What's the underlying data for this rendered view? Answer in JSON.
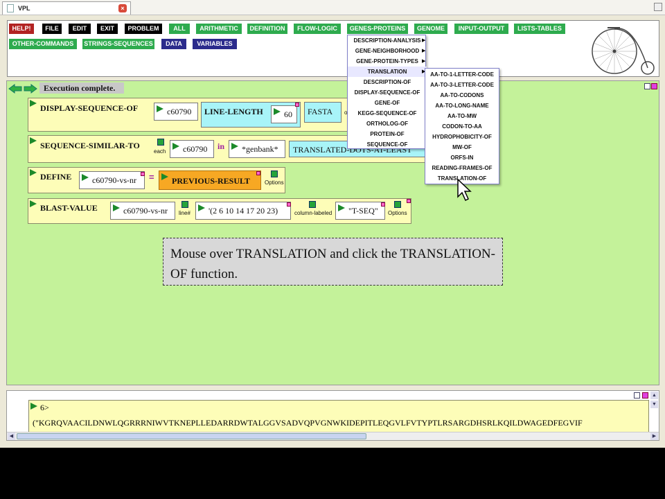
{
  "window": {
    "tab_title": "VPL"
  },
  "menubar": {
    "row1": [
      {
        "label": "HELP!",
        "color": "red"
      },
      {
        "label": "FILE",
        "color": "black"
      },
      {
        "label": "EDIT",
        "color": "black"
      },
      {
        "label": "EXIT",
        "color": "black"
      },
      {
        "label": "PROBLEM",
        "color": "black"
      },
      {
        "label": "ALL",
        "color": "green"
      },
      {
        "label": "ARITHMETIC",
        "color": "green"
      },
      {
        "label": "DEFINITION",
        "color": "green"
      },
      {
        "label": "FLOW-LOGIC",
        "color": "green"
      },
      {
        "label": "GENES-PROTEINS",
        "color": "green"
      },
      {
        "label": "GENOME",
        "color": "green"
      },
      {
        "label": "INPUT-OUTPUT",
        "color": "green"
      },
      {
        "label": "LISTS-TABLES",
        "color": "green"
      }
    ],
    "row2": [
      {
        "label": "OTHER-COMMANDS",
        "color": "green"
      },
      {
        "label": "STRINGS-SEQUENCES",
        "color": "green"
      },
      {
        "label": "DATA",
        "color": "blue"
      },
      {
        "label": "VARIABLES",
        "color": "blue"
      }
    ]
  },
  "workspace": {
    "status": "Execution complete.",
    "blocks": {
      "display": {
        "name": "DISPLAY-SEQUENCE-OF",
        "arg1": "c60790",
        "line_length_label": "LINE-LENGTH",
        "line_length_value": "60",
        "format": "FASTA",
        "trailing": "o"
      },
      "similar": {
        "name": "SEQUENCE-SIMILAR-TO",
        "each": "each",
        "arg1": "c60790",
        "in": "in",
        "arg2": "*genbank*",
        "translate_label": "TRANSLATED-DOTS-AT-LEAST"
      },
      "define": {
        "name": "DEFINE",
        "var": "c60790-vs-nr",
        "eq": "=",
        "value": "PREVIOUS-RESULT",
        "options": "Options"
      },
      "blast": {
        "name": "BLAST-VALUE",
        "arg1": "c60790-vs-nr",
        "line": "line#",
        "list": "'(2 6 10 14 17 20 23)",
        "column_labeled": "column-labeled",
        "seq": "\"T-SEQ\"",
        "options": "Options"
      }
    }
  },
  "genes_menu": [
    "DESCRIPTION-ANALYSIS",
    "GENE-NEIGHBORHOOD",
    "GENE-PROTEIN-TYPES",
    "TRANSLATION",
    "DESCRIPTION-OF",
    "DISPLAY-SEQUENCE-OF",
    "GENE-OF",
    "KEGG-SEQUENCE-OF",
    "ORTHOLOG-OF",
    "PROTEIN-OF",
    "SEQUENCE-OF"
  ],
  "translation_menu": [
    "AA-TO-1-LETTER-CODE",
    "AA-TO-3-LETTER-CODE",
    "AA-TO-CODONS",
    "AA-TO-LONG-NAME",
    "AA-TO-MW",
    "CODON-TO-AA",
    "HYDROPHOBICITY-OF",
    "MW-OF",
    "ORFS-IN",
    "READING-FRAMES-OF",
    "TRANSLATION-OF"
  ],
  "annotation": "Mouse over TRANSLATION and click the TRANSLATION-OF  function.",
  "output": {
    "prompt": "6>",
    "sequence": "(\"KGRQVAACILDNWLQGRRRNIWVTKNEPLLEDARRDWTALGGVSADVQPVGNWKIDEPITLEQGVLFVTYPTLRSARGDHSRLKQILDWAGEDFEGVIF"
  }
}
